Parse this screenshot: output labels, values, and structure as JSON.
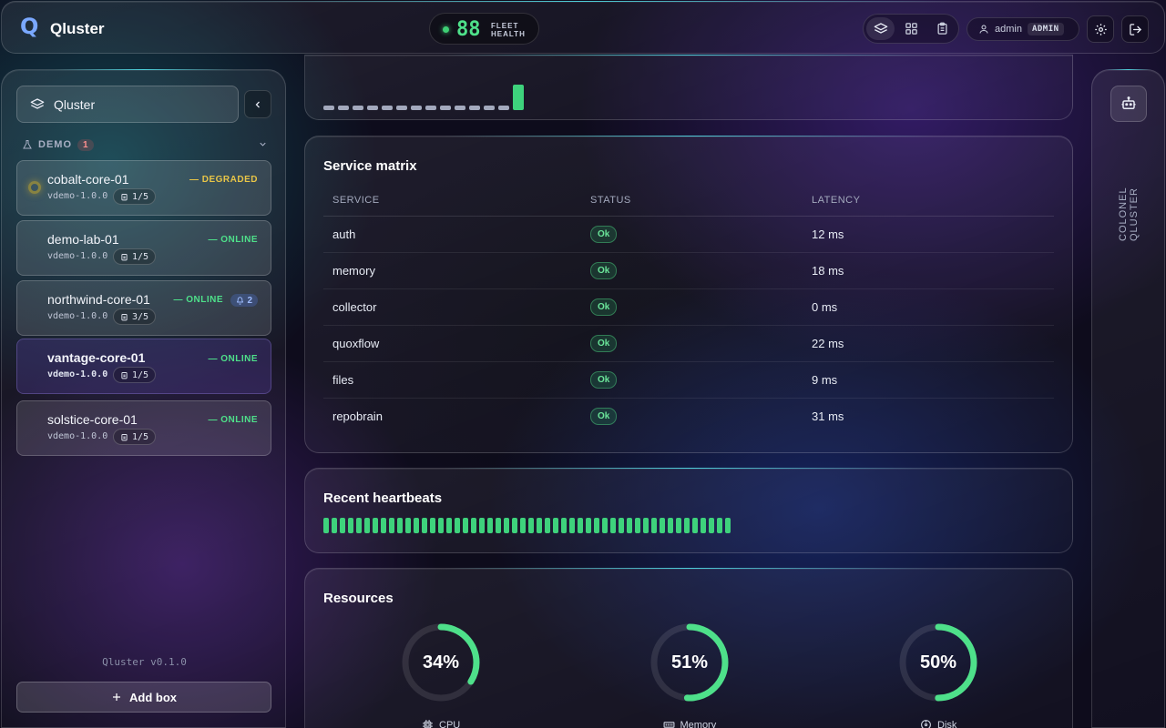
{
  "header": {
    "app_title": "Qluster",
    "logo_letter": "Q",
    "fleet_health_value": "88",
    "fleet_health_label": "FLEET HEALTH",
    "user_name": "admin",
    "user_role": "ADMIN",
    "views": [
      "layers-icon",
      "grid-icon",
      "clipboard-icon"
    ]
  },
  "sidebar": {
    "brand_label": "Qluster",
    "group": {
      "name": "DEMO",
      "count": "1"
    },
    "boxes": [
      {
        "name": "cobalt-core-01",
        "status": "— DEGRADED",
        "status_color": "#e8c547",
        "version": "vdemo-1.0.0",
        "slots": "1/5"
      },
      {
        "name": "demo-lab-01",
        "status": "— ONLINE",
        "status_color": "#4ee08a",
        "version": "vdemo-1.0.0",
        "slots": "1/5"
      },
      {
        "name": "northwind-core-01",
        "status": "— ONLINE",
        "status_color": "#4ee08a",
        "version": "vdemo-1.0.0",
        "slots": "3/5",
        "alerts": "2"
      },
      {
        "name": "vantage-core-01",
        "status": "— ONLINE",
        "status_color": "#4ee08a",
        "version": "vdemo-1.0.0",
        "slots": "1/5"
      },
      {
        "name": "solstice-core-01",
        "status": "— ONLINE",
        "status_color": "#4ee08a",
        "version": "vdemo-1.0.0",
        "slots": "1/5"
      }
    ],
    "version": "Qluster v0.1.0",
    "add_box_label": "Add box"
  },
  "service_matrix": {
    "title": "Service matrix",
    "columns": [
      "SERVICE",
      "STATUS",
      "LATENCY"
    ],
    "rows": [
      {
        "service": "auth",
        "status": "Ok",
        "latency": "12 ms"
      },
      {
        "service": "memory",
        "status": "Ok",
        "latency": "18 ms"
      },
      {
        "service": "collector",
        "status": "Ok",
        "latency": "0 ms"
      },
      {
        "service": "quoxflow",
        "status": "Ok",
        "latency": "22 ms"
      },
      {
        "service": "files",
        "status": "Ok",
        "latency": "9 ms"
      },
      {
        "service": "repobrain",
        "status": "Ok",
        "latency": "31 ms"
      }
    ]
  },
  "uptime_strip": {
    "idle_count": 13,
    "active_count": 1
  },
  "heartbeats": {
    "title": "Recent heartbeats",
    "count": 50
  },
  "resources": {
    "title": "Resources",
    "items": [
      {
        "label": "CPU",
        "percent": 34,
        "text": "34%",
        "icon": "chip-icon"
      },
      {
        "label": "Memory",
        "percent": 51,
        "text": "51%",
        "icon": "memory-icon"
      },
      {
        "label": "Disk",
        "percent": 50,
        "text": "50%",
        "icon": "disk-icon"
      }
    ]
  },
  "rail": {
    "label": "COLONEL QLUSTER"
  },
  "colors": {
    "accent": "#4ee08a",
    "degraded": "#e8c547",
    "teal_edge": "#50e6f0"
  }
}
